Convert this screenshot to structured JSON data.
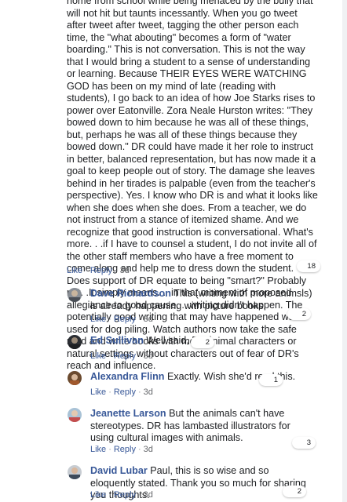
{
  "post": {
    "text": "home from school while being menaced by the bully that will not hit but taunts incessantly. When you go tweet after tweet after tweet, tagging the other person each time, the \"what abouting\" becomes a form of \"water boarding.\" This is not conversation. This is not the way that I would bring a student to a sense of understanding or learning. Because THEIR EYES WERE WATCHING GOD has been on my mind of late (reading with students), I go back to an idea of how Joe Starks rises to power over Eatonville. Zora Neale Hurston writes: \"They bowed down to him because he was all of these things, but, perhaps he was all of these things because they bowed down.\" DR could have made it her role to instruct in better, balanced representation, but has now made it a goal to keep people out of story. The damage she leaves behind in her tirades is palpable (even from the teacher's perspective). Yes. I know who DR is and what it looks like when she does when she does. From a teacher, we do not instruct from a stance of itemized shame. And we recognize that good instruction is conversational. What's more. . .if I have to counsel a student, I do not invite all of the other staff members who have a free moment to come along and help me to dress down the student. Does support of DR equate to being \"smart?\" Probably not. .It simply means. . .in that moment of proposed allegiance to good cause. . .writing didn't happen. The potentially good writing that may have happened was used for dog piling. Watch authors now take the safe road and write books with more animal characters or natural settings without characters out of fear of DR's reach and influence.",
    "like_label": "Like",
    "reply_label": "Reply",
    "time": "3d",
    "reaction_count": "18"
  },
  "comments": [
    {
      "name": "Dave Richardson",
      "text": "This (writing with more animsls) is already happening with picture books.",
      "like_label": "Like",
      "reply_label": "Reply",
      "time": "3d",
      "reaction_count": "2"
    },
    {
      "name": "Ed Sullivan",
      "text": "Well said, Paul.",
      "like_label": "Like",
      "reply_label": "Reply",
      "time": "3d",
      "reaction_count": "2"
    },
    {
      "name": "Alexandra Flinn",
      "text": "Exactly. Wish she'd read this.",
      "like_label": "Like",
      "reply_label": "Reply",
      "time": "3d",
      "reaction_count": "1"
    },
    {
      "name": "Jeanette Larson",
      "text": "But the animals can't have stereotypes. DR has lambasted illustrators for using cultural images with animals.",
      "like_label": "Like",
      "reply_label": "Reply",
      "time": "3d",
      "reaction_count": "3"
    },
    {
      "name": "David Lubar",
      "text": "Paul, this is so wise and so eloquently stated. Thank you so much for sharing you thoughts.",
      "like_label": "Like",
      "reply_label": "Reply",
      "time": "3d",
      "reaction_count": "2"
    }
  ],
  "colors": {
    "link": "#385898",
    "meta": "#65676b"
  }
}
